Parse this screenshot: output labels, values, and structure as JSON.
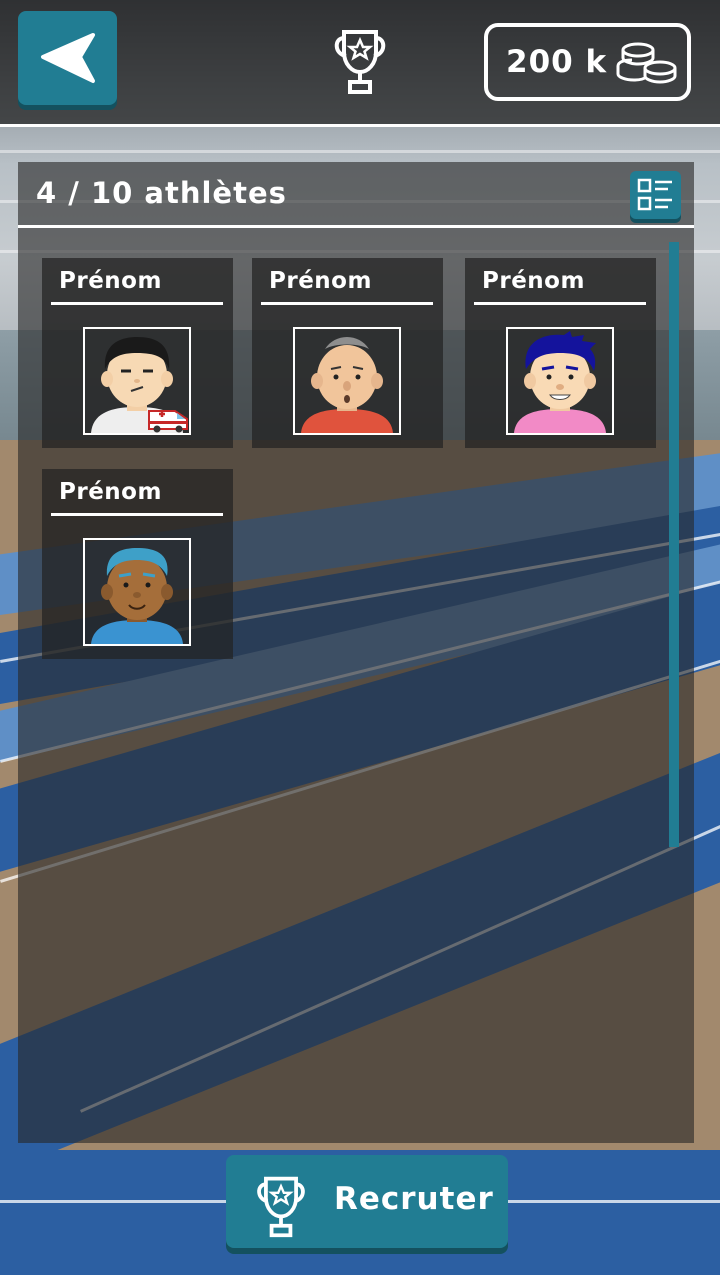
{
  "header": {
    "back_icon": "back-arrow-icon",
    "trophy_icon": "trophy-icon",
    "coins": "200 k",
    "coins_icon": "coins-icon"
  },
  "panel": {
    "count_label": "4 / 10 athlètes",
    "list_view_icon": "list-view-icon"
  },
  "athletes": [
    {
      "name": "Prénom",
      "status": "injured",
      "badge_icon": "ambulance-icon"
    },
    {
      "name": "Prénom",
      "status": ""
    },
    {
      "name": "Prénom",
      "status": ""
    },
    {
      "name": "Prénom",
      "status": ""
    }
  ],
  "recruit_button": {
    "label": "Recruter",
    "icon": "trophy-icon"
  },
  "colors": {
    "accent": "#217d93",
    "accent_shadow": "#14515f",
    "track_blue": "#2c5fa2"
  }
}
